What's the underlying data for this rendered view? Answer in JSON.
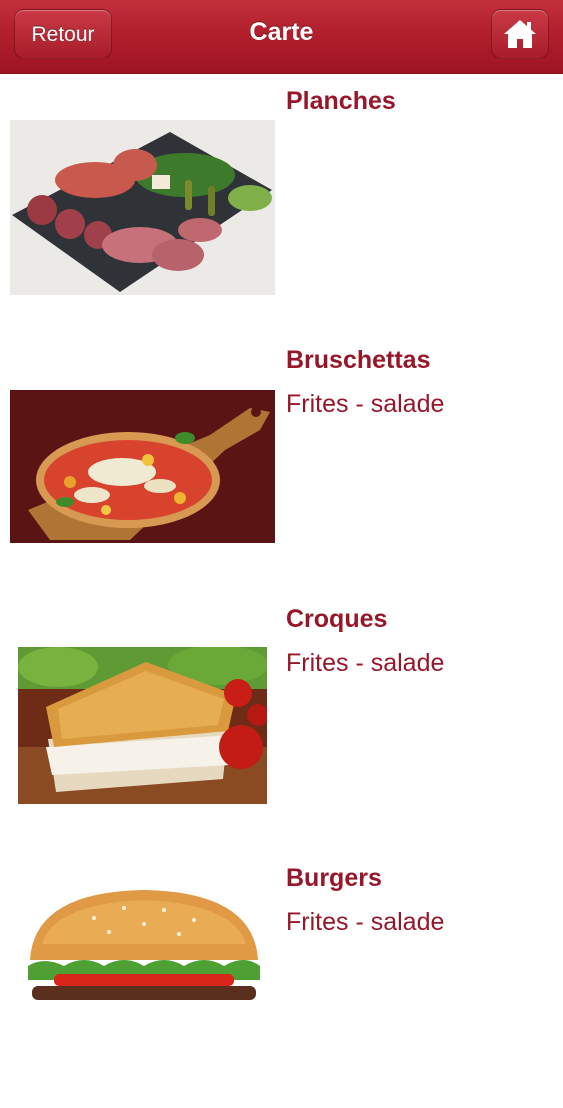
{
  "header": {
    "title": "Carte",
    "back_label": "Retour",
    "home_icon": "home-icon"
  },
  "colors": {
    "accent": "#b21f2c",
    "text": "#97172a"
  },
  "menu": [
    {
      "name": "Planches",
      "description": "",
      "image": "charcuterie-board-image"
    },
    {
      "name": "Bruschettas",
      "description": "Frites - salade",
      "image": "bruschetta-image"
    },
    {
      "name": "Croques",
      "description": "Frites - salade",
      "image": "croque-monsieur-image"
    },
    {
      "name": "Burgers",
      "description": "Frites - salade",
      "image": "burger-image"
    }
  ]
}
